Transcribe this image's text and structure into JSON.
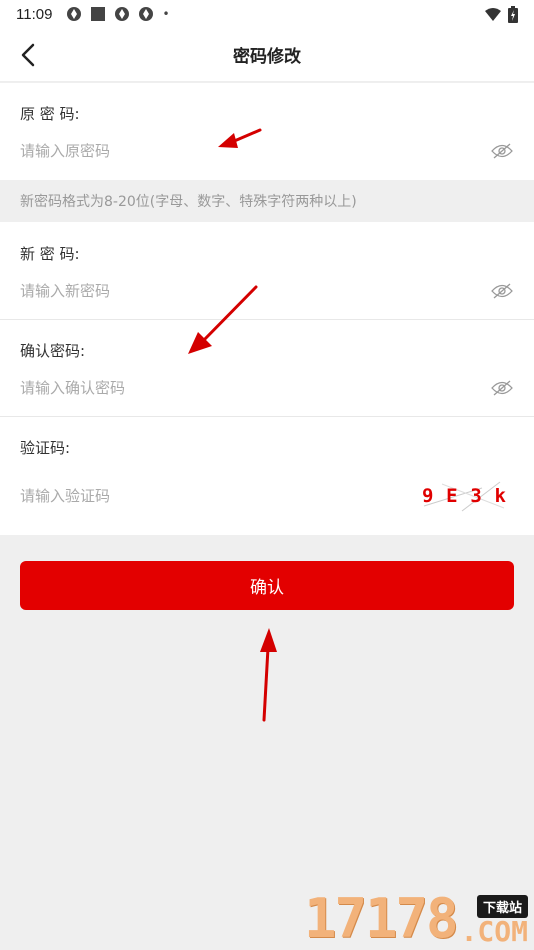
{
  "status_bar": {
    "time": "11:09",
    "notification_icons": [
      "app-notification-icon",
      "square-icon",
      "app-notification-icon",
      "app-notification-icon"
    ],
    "dot": "•",
    "right_icons": [
      "wifi-icon",
      "battery-icon"
    ]
  },
  "header": {
    "title": "密码修改",
    "back_icon": "chevron-left-icon"
  },
  "form": {
    "old_password": {
      "label": "原 密 码:",
      "placeholder": "请输入原密码",
      "icon": "eye-off-icon"
    },
    "hint": "新密码格式为8-20位(字母、数字、特殊字符两种以上)",
    "new_password": {
      "label": "新 密 码:",
      "placeholder": "请输入新密码",
      "icon": "eye-off-icon"
    },
    "confirm_password": {
      "label": "确认密码:",
      "placeholder": "请输入确认密码",
      "icon": "eye-off-icon"
    },
    "captcha": {
      "label": "验证码:",
      "placeholder": "请输入验证码",
      "chars": [
        "9",
        "E",
        "3",
        "k"
      ]
    }
  },
  "actions": {
    "confirm_label": "确认"
  },
  "watermark": {
    "number": "17178",
    "tag": "下载站",
    "suffix": ".COM"
  },
  "colors": {
    "accent": "#e30000",
    "arrow": "#d40000",
    "background": "#efefef"
  }
}
